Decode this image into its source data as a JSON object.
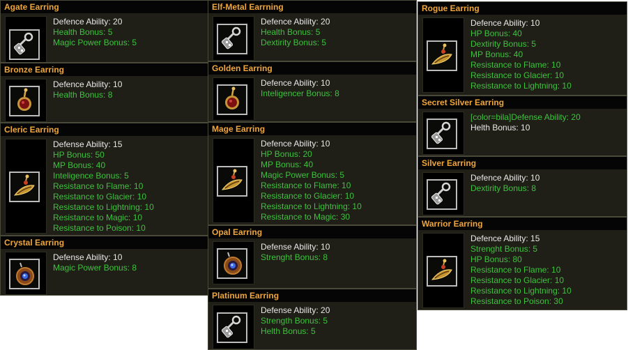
{
  "palette": {
    "title": "#f0a63a",
    "white_stat": "#e8e8e8",
    "green_stat": "#3ec23e",
    "card_bg": "#1f1f17",
    "title_bg": "#050505",
    "frame": "#bcbcbc"
  },
  "items": {
    "agate": {
      "name": "Agate Earring",
      "icon": "silver-earring-icon",
      "stats": [
        {
          "text": "Defence Ability: 20",
          "tone": "white"
        },
        {
          "text": "Health Bonus: 5",
          "tone": "green"
        },
        {
          "text": "Magic Power Bonus: 5",
          "tone": "green"
        }
      ]
    },
    "bronze": {
      "name": "Bronze Earring",
      "icon": "red-gem-earring-icon",
      "stats": [
        {
          "text": "Defence Ability: 10",
          "tone": "white"
        },
        {
          "text": "Health Bonus: 8",
          "tone": "green"
        }
      ]
    },
    "cleric": {
      "name": "Cleric Earring",
      "icon": "gold-earring-icon",
      "stats": [
        {
          "text": "Defense Ability: 15",
          "tone": "white"
        },
        {
          "text": "HP Bonus: 50",
          "tone": "green"
        },
        {
          "text": "MP Bonus: 40",
          "tone": "green"
        },
        {
          "text": "Inteligence Bonus: 5",
          "tone": "green"
        },
        {
          "text": "Resistance to Flame: 10",
          "tone": "green"
        },
        {
          "text": "Resistance to Glacier: 10",
          "tone": "green"
        },
        {
          "text": "Resistance to Lightning: 10",
          "tone": "green"
        },
        {
          "text": "Resistance to Magic: 10",
          "tone": "green"
        },
        {
          "text": "Resistance to Poison: 10",
          "tone": "green"
        }
      ]
    },
    "crystal": {
      "name": "Crystal Earring",
      "icon": "blue-orb-earring-icon",
      "stats": [
        {
          "text": "Defense Ability: 10",
          "tone": "white"
        },
        {
          "text": "Magic Power Bonus: 8",
          "tone": "green"
        }
      ]
    },
    "elf_metal": {
      "name": "Elf-Metal Earrning",
      "icon": "silver-earring-icon",
      "stats": [
        {
          "text": "Defence Ability: 20",
          "tone": "white"
        },
        {
          "text": "Health Bonus: 5",
          "tone": "green"
        },
        {
          "text": "Dextirity Bonus: 5",
          "tone": "green"
        }
      ]
    },
    "golden": {
      "name": "Golden Earring",
      "icon": "red-gem-earring-icon",
      "stats": [
        {
          "text": "Defence Ability: 10",
          "tone": "white"
        },
        {
          "text": "Inteligencer Bonus: 8",
          "tone": "green"
        }
      ]
    },
    "mage": {
      "name": "Mage Earring",
      "icon": "gold-earring-icon",
      "stats": [
        {
          "text": "Defence Ability: 10",
          "tone": "white"
        },
        {
          "text": "HP Bonus: 20",
          "tone": "green"
        },
        {
          "text": "MP Bonus: 40",
          "tone": "green"
        },
        {
          "text": "Magic Power Bonus: 5",
          "tone": "green"
        },
        {
          "text": "Resistance to Flame: 10",
          "tone": "green"
        },
        {
          "text": "Resistance to Glacier: 10",
          "tone": "green"
        },
        {
          "text": "Resistance to Lightning: 10",
          "tone": "green"
        },
        {
          "text": "Resistance to Magic: 30",
          "tone": "green"
        }
      ]
    },
    "opal": {
      "name": "Opal Earring",
      "icon": "blue-orb-earring-icon",
      "stats": [
        {
          "text": "Defense Ability: 10",
          "tone": "white"
        },
        {
          "text": "Strenght Bonus: 8",
          "tone": "green"
        }
      ]
    },
    "platinum": {
      "name": "Platinum Earring",
      "icon": "silver-earring-icon",
      "stats": [
        {
          "text": "Defense Ability: 20",
          "tone": "white"
        },
        {
          "text": "Strength Bonus: 5",
          "tone": "green"
        },
        {
          "text": "Helth Bonus: 5",
          "tone": "green"
        }
      ]
    },
    "rogue": {
      "name": "Rogue Earring",
      "icon": "gold-earring-icon",
      "stats": [
        {
          "text": "Defence Ability: 10",
          "tone": "white"
        },
        {
          "text": "HP Bonus: 40",
          "tone": "green"
        },
        {
          "text": "Dextirity Bonus: 5",
          "tone": "green"
        },
        {
          "text": "MP Bonus: 40",
          "tone": "green"
        },
        {
          "text": "Resistance to Flame: 10",
          "tone": "green"
        },
        {
          "text": "Resistance to Glacier: 10",
          "tone": "green"
        },
        {
          "text": "Resistance to Lightning: 10",
          "tone": "green"
        }
      ]
    },
    "secret_silver": {
      "name": "Secret Silver Earring",
      "icon": "silver-earring-icon",
      "stats": [
        {
          "text": "[color=bila]Defense Ability: 20",
          "tone": "green"
        },
        {
          "text": "Helth Bonus: 10",
          "tone": "white"
        }
      ]
    },
    "silver": {
      "name": "Silver Earring",
      "icon": "silver-earring-icon",
      "stats": [
        {
          "text": "Defence Ability: 10",
          "tone": "white"
        },
        {
          "text": "Dextirity Bonus: 8",
          "tone": "green"
        }
      ]
    },
    "warrior": {
      "name": "Warrior Earring",
      "icon": "gold-earring-icon",
      "stats": [
        {
          "text": "Defence Ability: 15",
          "tone": "white"
        },
        {
          "text": "Strenght Bonus: 5",
          "tone": "green"
        },
        {
          "text": "HP Bonus: 80",
          "tone": "green"
        },
        {
          "text": "Resistance to Flame: 10",
          "tone": "green"
        },
        {
          "text": "Resistance to Glacier: 10",
          "tone": "green"
        },
        {
          "text": "Resistance to Lightning: 10",
          "tone": "green"
        },
        {
          "text": "Resistance to Poison: 30",
          "tone": "green"
        }
      ]
    }
  }
}
